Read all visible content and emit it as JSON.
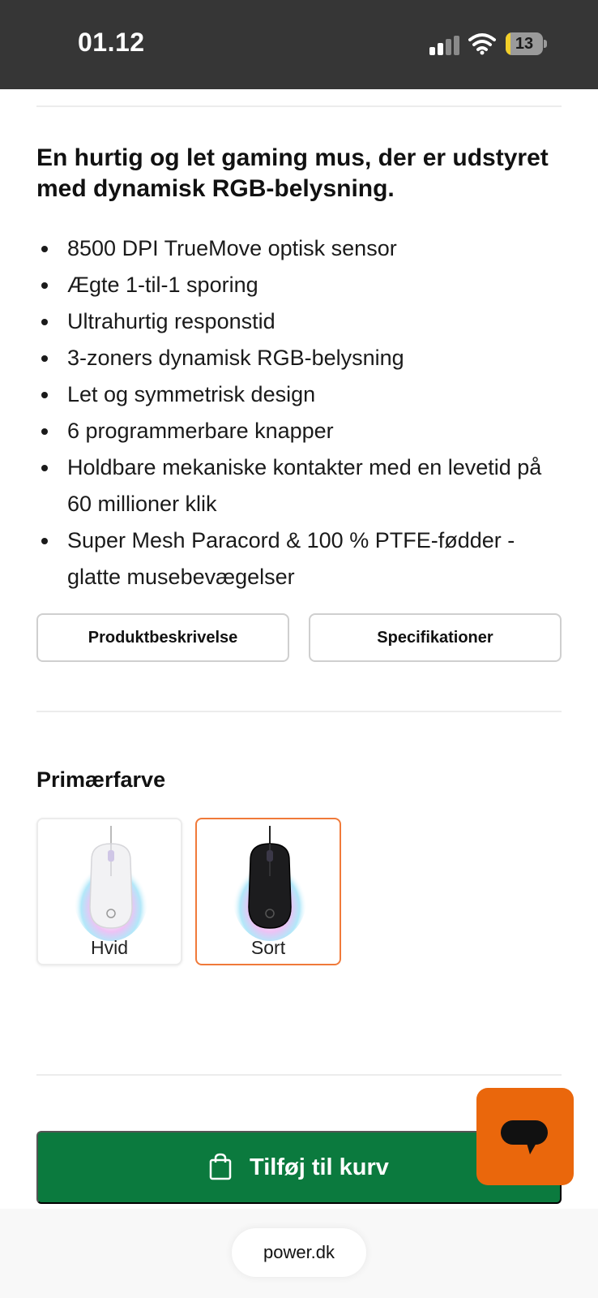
{
  "status_bar": {
    "time": "01.12",
    "battery_level": "13",
    "battery_fraction": 0.13,
    "signal_bars_active": 2,
    "signal_bars_total": 4
  },
  "product": {
    "headline": "En hurtig og let gaming mus, der er udstyret med dynamisk RGB-belysning.",
    "features": [
      "8500 DPI TrueMove optisk sensor",
      "Ægte 1-til-1 sporing",
      "Ultrahurtig responstid",
      "3-zoners dynamisk RGB-belysning",
      "Let og symmetrisk design",
      "6 programmerbare knapper",
      "Holdbare mekaniske kontakter med en levetid på 60 millioner klik",
      "Super Mesh Paracord & 100 % PTFE-fødder - glatte musebevægelser"
    ]
  },
  "tabs": {
    "description": "Produktbeskrivelse",
    "specifications": "Specifikationer"
  },
  "color_picker": {
    "heading": "Primærfarve",
    "options": [
      {
        "label": "Hvid",
        "selected": false
      },
      {
        "label": "Sort",
        "selected": true
      }
    ]
  },
  "cart": {
    "label": "Tilføj til kurv"
  },
  "browser": {
    "url": "power.dk"
  },
  "colors": {
    "status_bar_bg": "#363636",
    "cart_green": "#0b7a3e",
    "chat_orange": "#ea670c",
    "selected_border": "#f07a3a",
    "battery_yellow": "#f2cf2a"
  }
}
